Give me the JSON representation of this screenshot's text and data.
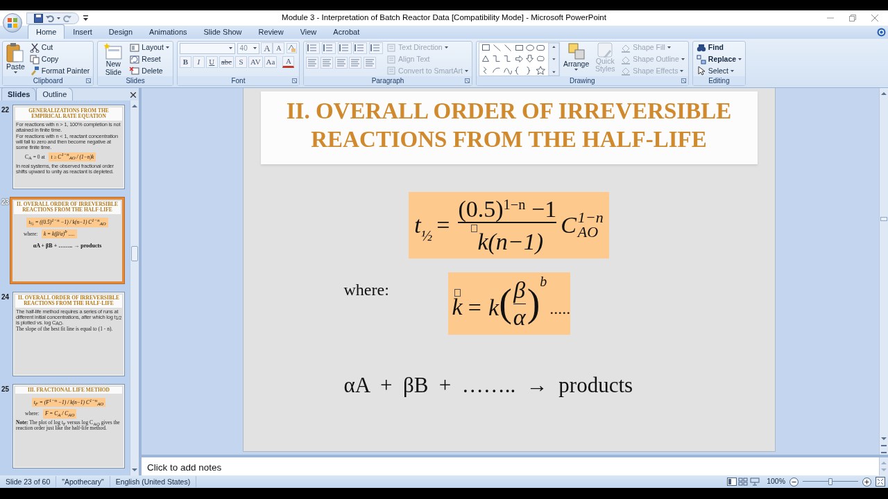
{
  "window": {
    "title": "Module 3 - Interpretation of Batch Reactor Data [Compatibility Mode] - Microsoft PowerPoint"
  },
  "ribbon_tabs": [
    {
      "label": "Home",
      "selected": true
    },
    {
      "label": "Insert",
      "selected": false
    },
    {
      "label": "Design",
      "selected": false
    },
    {
      "label": "Animations",
      "selected": false
    },
    {
      "label": "Slide Show",
      "selected": false
    },
    {
      "label": "Review",
      "selected": false
    },
    {
      "label": "View",
      "selected": false
    },
    {
      "label": "Acrobat",
      "selected": false
    }
  ],
  "clipboard": {
    "label": "Clipboard",
    "big_button": "Paste",
    "items": [
      "Cut",
      "Copy",
      "Format Painter"
    ]
  },
  "slides_group": {
    "label": "Slides",
    "big_button": "New Slide",
    "items": [
      "Layout",
      "Reset",
      "Delete"
    ]
  },
  "font": {
    "label": "Font",
    "size": "40",
    "size_buttons": [
      "A",
      "A"
    ],
    "format_buttons": [
      "B",
      "I",
      "U",
      "abc",
      "S",
      "AV",
      "Aa",
      "A"
    ]
  },
  "paragraph": {
    "label": "Paragraph",
    "items": [
      {
        "label": "Text Direction",
        "disabled": true
      },
      {
        "label": "Align Text",
        "disabled": true
      },
      {
        "label": "Convert to SmartArt",
        "disabled": true
      }
    ]
  },
  "drawing": {
    "label": "Drawing",
    "arrange": "Arrange",
    "quick_styles": {
      "label": "Quick Styles",
      "disabled": true
    },
    "items": [
      {
        "label": "Shape Fill",
        "disabled": true
      },
      {
        "label": "Shape Outline",
        "disabled": true
      },
      {
        "label": "Shape Effects",
        "disabled": true
      }
    ]
  },
  "editing": {
    "label": "Editing",
    "items": [
      "Find",
      "Replace",
      "Select"
    ]
  },
  "pane_tabs": [
    {
      "label": "Slides",
      "selected": true
    },
    {
      "label": "Outline",
      "selected": false
    }
  ],
  "thumbnails": [
    {
      "number": "22",
      "selected": false,
      "title": "GENERALIZATIONS FROM THE EMPIRICAL RATE EQUATION",
      "blocks": [
        {
          "kind": "bullet",
          "text": "For reactions with n > 1, 100% completion is not attained in finite time."
        },
        {
          "kind": "bullet",
          "text": "For reactions with n < 1, reactant concentration will fall to zero and then become negative at some finite time."
        },
        {
          "kind": "labeled_box",
          "label": "C$_{A}$ = 0   at",
          "text": "t ≥ C$^{1−n}$$_{AO}$ / (1−n)k"
        },
        {
          "kind": "bullet",
          "text": "In real systems, the observed fractional order shifts upward to unity as reactant is depleted."
        }
      ]
    },
    {
      "number": "23",
      "selected": true,
      "title": "II. OVERALL ORDER OF IRREVERSIBLE REACTIONS FROM THE HALF-LIFE",
      "blocks": [
        {
          "kind": "box",
          "text": "t$_{½}$ = ((0.5)$^{1−n}$ −1) / k(n−1) C$^{1−n}$$_{AO}$"
        },
        {
          "kind": "labeled_box",
          "label": "where:",
          "text": "k = k(β/α)$^{b}$ ....."
        },
        {
          "kind": "line",
          "text": "αA + βB + …….. → products"
        }
      ]
    },
    {
      "number": "24",
      "selected": false,
      "title": "II. OVERALL ORDER OF IRREVERSIBLE REACTIONS FROM THE HALF-LIFE",
      "blocks": [
        {
          "kind": "bullet",
          "text": "The half-life method requires a series of runs at different initial concentrations, after which log t$_{1/2}$ is plotted vs. log C$_{AO}$."
        },
        {
          "kind": "note",
          "text": "The slope of the best fit line is equal to (1 - n)."
        }
      ]
    },
    {
      "number": "25",
      "selected": false,
      "title": "III. FRACTIONAL LIFE METHOD",
      "blocks": [
        {
          "kind": "box",
          "text": "t$_{F}$ = (F$^{1−n}$ −1) / k(n−1) C$^{1−n}$$_{AO}$"
        },
        {
          "kind": "labeled_box",
          "label": "where:",
          "text": "F = C$_{A}$ / C$_{AO}$"
        },
        {
          "kind": "note",
          "text": "**Note:** The plot of log t$_{F}$ versus log C$_{AO}$ gives the reaction order just like the half-life method."
        }
      ]
    }
  ],
  "slide": {
    "title_lines": [
      "II. OVERALL ORDER OF IRREVERSIBLE",
      "REACTIONS FROM THE HALF-LIFE"
    ],
    "half_life_equation": {
      "lhs": "t",
      "lhs_sub": "½",
      "equals": "=",
      "numerator": "(0.5)$^{1−n}$ −1",
      "denominator": "k(n−1)",
      "factor": "C",
      "factor_sup": "1−n",
      "factor_sub": "AO"
    },
    "where_label": "where:",
    "k_equation": {
      "lhs": "k",
      "middle": "= k",
      "open": "(",
      "numerator": "β",
      "denominator": "α",
      "close": ")",
      "exponent": "b",
      "tail": "....."
    },
    "reaction": "αA  +  βB  +  ……..  →  products"
  },
  "notes": {
    "placeholder": "Click to add notes"
  },
  "status_bar": {
    "slide": "Slide 23 of 60",
    "theme": "\"Apothecary\"",
    "language": "English (United States)",
    "zoom": "100%",
    "zoom_slider": {
      "level": 0.5
    }
  }
}
